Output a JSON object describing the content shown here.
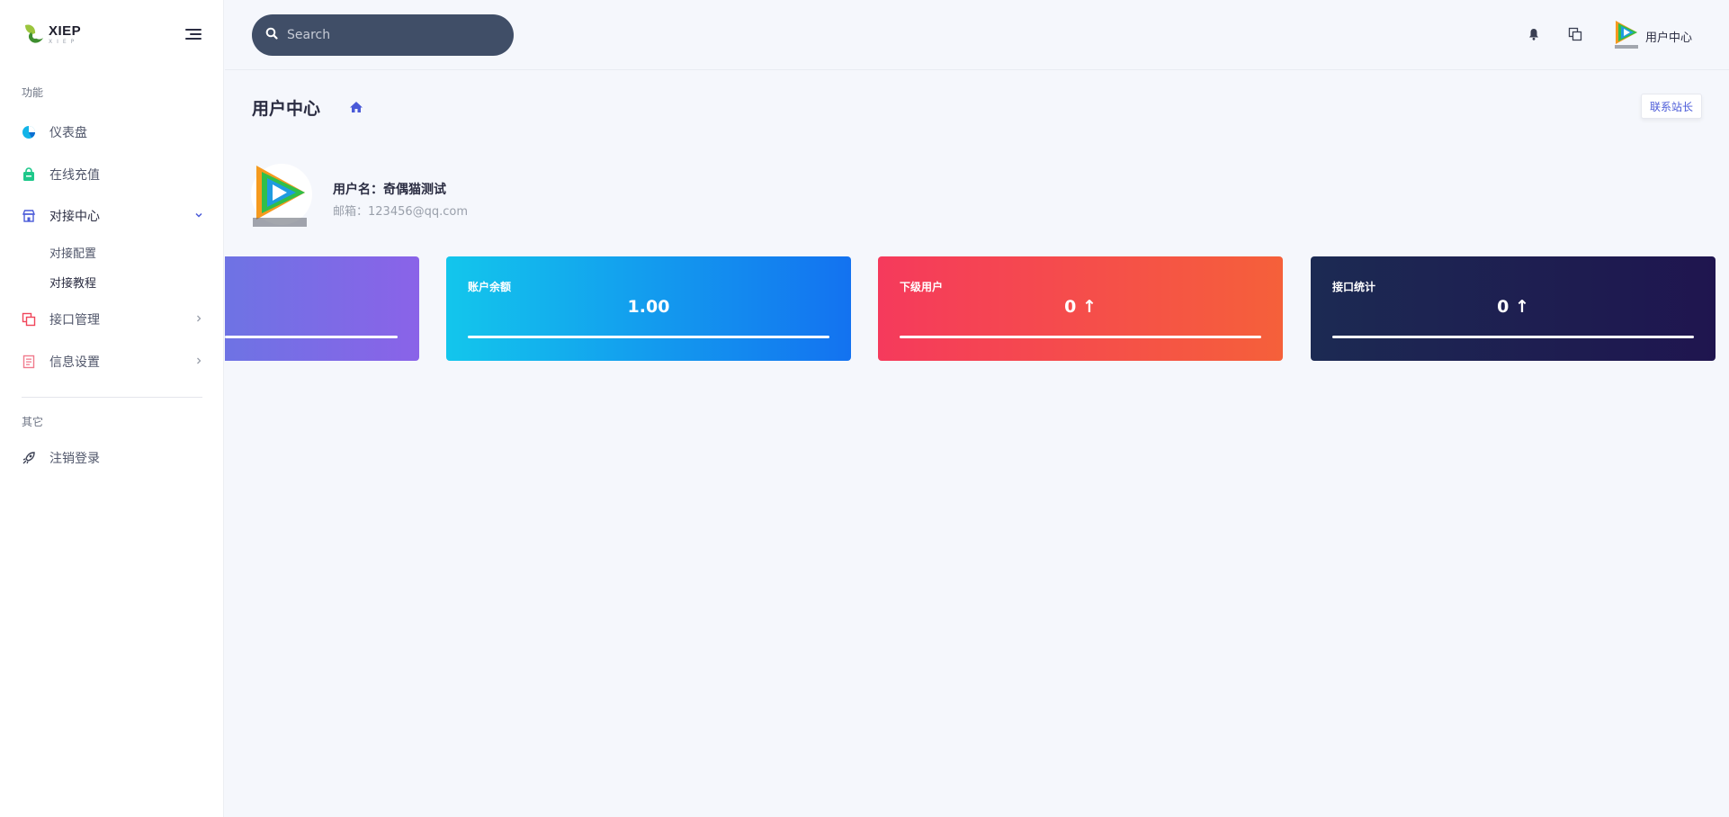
{
  "brand": {
    "name": "XIEP",
    "sub": "XIEP"
  },
  "sidebar": {
    "section_main": "功能",
    "section_other": "其它",
    "items": [
      {
        "label": "仪表盘",
        "icon": "pie-chart-icon"
      },
      {
        "label": "在线充值",
        "icon": "bag-icon"
      },
      {
        "label": "对接中心",
        "icon": "store-icon",
        "expanded": true,
        "children": [
          {
            "label": "对接配置"
          },
          {
            "label": "对接教程"
          }
        ]
      },
      {
        "label": "接口管理",
        "icon": "copy-icon"
      },
      {
        "label": "信息设置",
        "icon": "document-icon"
      }
    ],
    "logout": {
      "label": "注销登录",
      "icon": "rocket-icon"
    }
  },
  "topbar": {
    "search_placeholder": "Search",
    "user_label": "用户中心"
  },
  "page": {
    "title": "用户中心",
    "contact_button": "联系站长"
  },
  "profile": {
    "username": "用户名：奇偶猫测试",
    "email": "邮箱：123456@qq.com"
  },
  "cards": [
    {
      "title": "",
      "value": ""
    },
    {
      "title": "账户余额",
      "value": "1.00"
    },
    {
      "title": "下级用户",
      "value": "0 ↑"
    },
    {
      "title": "接口统计",
      "value": "0 ↑"
    }
  ],
  "colors": {
    "sidebar_bg": "#ffffff",
    "page_bg": "#f5f7fc",
    "search_bg": "#404e67",
    "accent": "#4a5ad8",
    "card_purple": "#7a6be6",
    "card_blue": "#1398ee",
    "card_red": "#f54a4c",
    "card_navy": "#1d2051"
  }
}
